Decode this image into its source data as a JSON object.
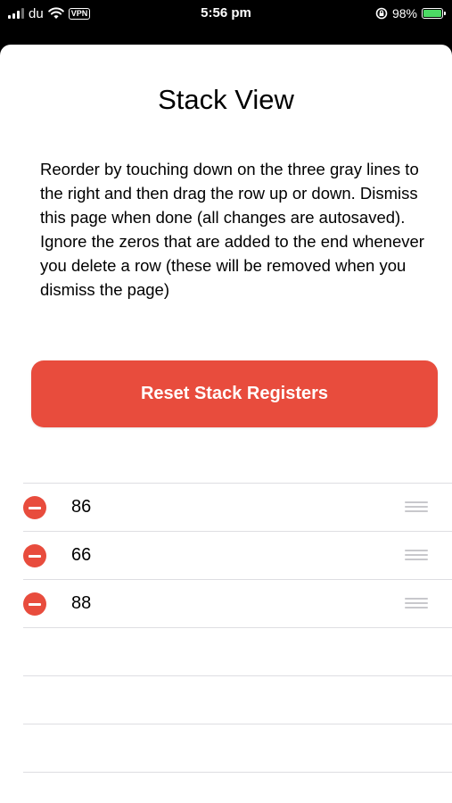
{
  "status_bar": {
    "carrier": "du",
    "vpn": "VPN",
    "time": "5:56 pm",
    "battery_percent": "98%",
    "battery_level": 0.98,
    "battery_color": "#4cd964",
    "icons": [
      "signal-bars-icon",
      "wifi-icon",
      "orientation-lock-icon",
      "battery-charging-icon"
    ]
  },
  "page": {
    "title": "Stack View",
    "instructions": "Reorder by touching down on the three gray lines to the right and then drag the row up or down. Dismiss this page when done (all changes are autosaved). Ignore the zeros that are added to the end whenever you delete a row (these will be removed when you dismiss the page)",
    "reset_button_label": "Reset Stack Registers",
    "accent_color": "#e84c3d"
  },
  "stack": {
    "rows": [
      {
        "value": "86"
      },
      {
        "value": "66"
      },
      {
        "value": "88"
      }
    ],
    "empty_rows": 3
  }
}
